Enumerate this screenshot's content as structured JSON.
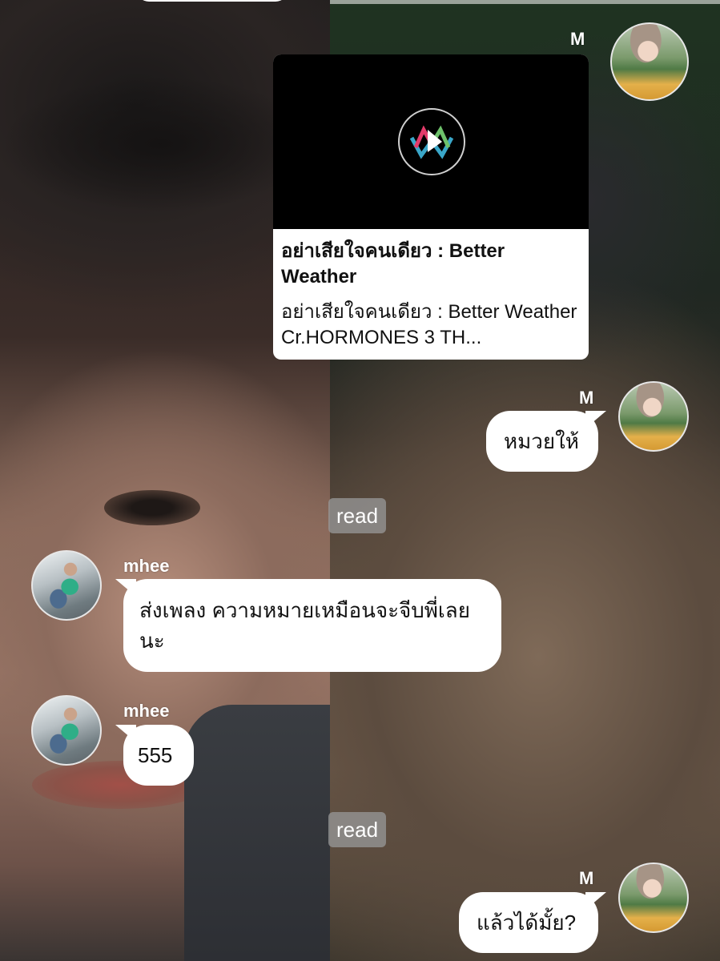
{
  "chat": {
    "messages": [
      {
        "sender": "M",
        "type": "link-card",
        "card_title": "อย่าเสียใจคนเดียว : Better Weather",
        "card_description": "อย่าเสียใจคนเดียว : Better Weather Cr.HORMONES 3 TH..."
      },
      {
        "sender": "M",
        "type": "text",
        "text": "หมวยให้"
      },
      {
        "type": "status",
        "text": "read"
      },
      {
        "sender": "mhee",
        "type": "text",
        "text": "ส่งเพลง ความหมายเหมือนจะจีบพี่เลยนะ"
      },
      {
        "sender": "mhee",
        "type": "text",
        "text": "555"
      },
      {
        "type": "status",
        "text": "read"
      },
      {
        "sender": "M",
        "type": "text",
        "text": "แล้วได้มั้ย?"
      }
    ]
  },
  "icons": {
    "link_thumbnail": "play-logo-icon"
  },
  "colors": {
    "bubble": "#ffffff",
    "read_badge": "#969696",
    "card_thumbnail_bg": "#000000"
  }
}
